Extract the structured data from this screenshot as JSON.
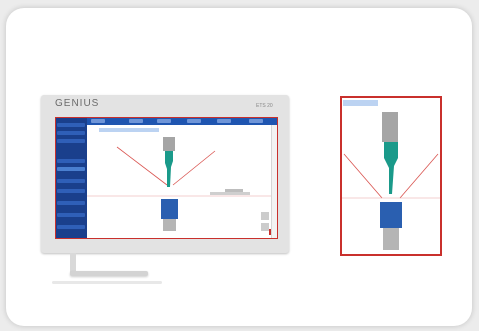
{
  "monitor": {
    "brand": "GENIUS",
    "model": "ETS 20"
  },
  "colors": {
    "accent_red": "#c9302c",
    "panel_blue": "#1a3f8c",
    "bar_blue": "#1f55b0",
    "tool_teal": "#1a9a8a",
    "die_blue": "#2a5fb0",
    "tool_grey": "#9a9a9a"
  },
  "icons": {
    "punch": "punch-tool-icon",
    "die": "die-block-icon"
  }
}
